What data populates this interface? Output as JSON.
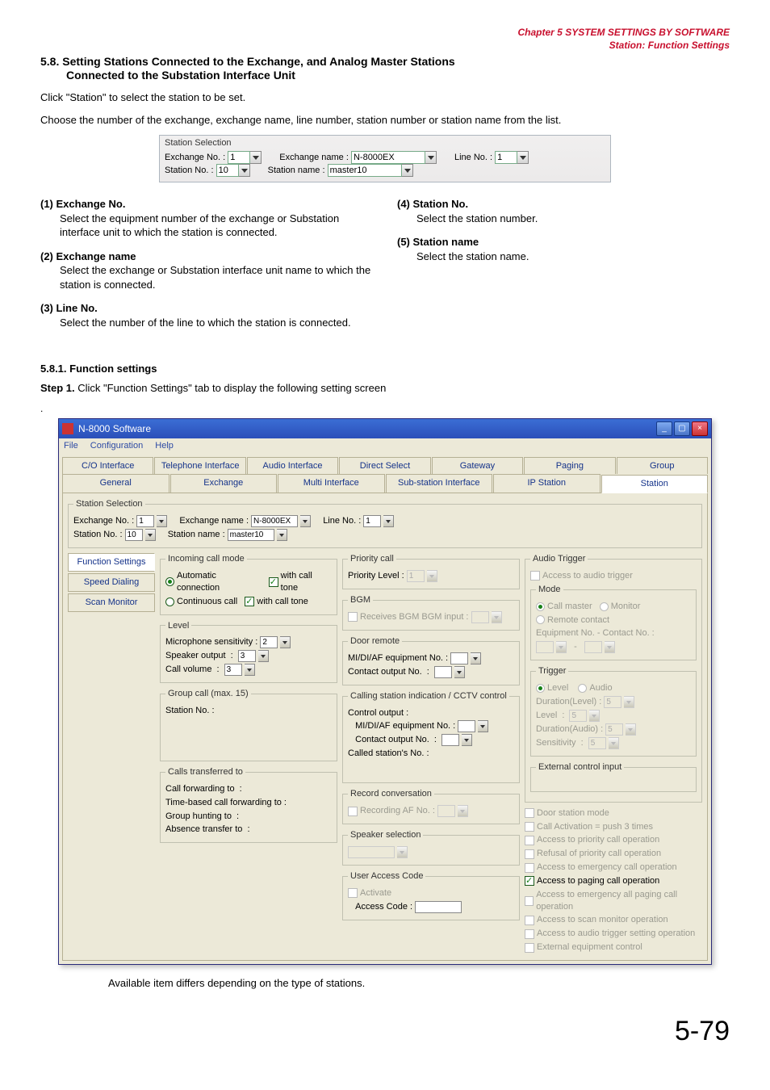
{
  "header": {
    "chapter_prefix": "Chapter 5",
    "chapter_rest": "   SYSTEM SETTINGS BY SOFTWARE",
    "subhead": "Station: Function Settings"
  },
  "section": {
    "title_line1": "5.8. Setting Stations Connected to the Exchange, and Analog Master Stations",
    "title_line2": "Connected to the Substation Interface Unit"
  },
  "intro1": "Click \"Station\" to select the station to be set.",
  "intro2": "Choose the number of the exchange, exchange name, line number, station number or station name from the list.",
  "selbox": {
    "legend": "Station Selection",
    "exch_no_label": "Exchange No. :",
    "exch_no_val": "1",
    "exch_name_label": "Exchange name :",
    "exch_name_val": "N-8000EX",
    "line_no_label": "Line No. :",
    "line_no_val": "1",
    "stn_no_label": "Station No.    :",
    "stn_no_val": "10",
    "stn_name_label": "Station name    :",
    "stn_name_val": "master10"
  },
  "items": {
    "n1": {
      "head": "(1)  Exchange No.",
      "body": "Select the equipment number of the exchange or Substation interface unit to which the station is connected."
    },
    "n2": {
      "head": "(2)  Exchange name",
      "body": "Select the exchange or Substation interface unit name to which the station is connected."
    },
    "n3": {
      "head": "(3)  Line No.",
      "body": "Select the number of the line to which the station is connected."
    },
    "n4": {
      "head": "(4)  Station No.",
      "body": "Select the station number."
    },
    "n5": {
      "head": "(5)  Station name",
      "body": "Select the station name."
    }
  },
  "substep": {
    "title": "5.8.1. Function settings",
    "step1_label": "Step 1.",
    "step1_text": " Click \"Function Settings\" tab to display the following setting screen"
  },
  "win": {
    "title": "N-8000 Software",
    "menus": [
      "File",
      "Configuration",
      "Help"
    ],
    "tabs_top": [
      "C/O Interface",
      "Telephone Interface",
      "Audio Interface",
      "Direct Select",
      "Gateway",
      "Paging",
      "Group"
    ],
    "tabs_bot": [
      "General",
      "Exchange",
      "Multi Interface",
      "Sub-station Interface",
      "IP Station",
      "Station"
    ],
    "vtabs": [
      "Function Settings",
      "Speed Dialing",
      "Scan Monitor"
    ],
    "selection": {
      "legend": "Station Selection",
      "exch_no_l": "Exchange No. :",
      "exch_no_v": "1",
      "exch_name_l": "Exchange name :",
      "exch_name_v": "N-8000EX",
      "line_no_l": "Line No. :",
      "line_no_v": "1",
      "stn_no_l": "Station No.    :",
      "stn_no_v": "10",
      "stn_name_l": "Station name    :",
      "stn_name_v": "master10"
    },
    "mid": {
      "incoming_legend": "Incoming call mode",
      "auto_conn": "Automatic connection",
      "with_tone1": "with call tone",
      "cont_call": "Continuous call",
      "with_tone2": "with call tone",
      "level_legend": "Level",
      "mic_sens": "Microphone sensitivity :",
      "mic_sens_v": "2",
      "spk_out": "Speaker output",
      "spk_out_v": "3",
      "call_vol": "Call volume",
      "call_vol_v": "3",
      "group_legend": "Group call (max. 15)",
      "stn_no_l": "Station No. :",
      "calls_transferred": "Calls transferred to",
      "call_forwarding": "Call forwarding to",
      "time_based": "Time-based call forwarding to :",
      "group_hunting": "Group hunting to",
      "absence": "Absence transfer to",
      "priority_legend": "Priority call",
      "priority_level_l": "Priority Level :",
      "priority_level_v": "1",
      "bgm_legend": "BGM",
      "receives_bgm": "Receives BGM   BGM input :",
      "door_legend": "Door remote",
      "midi_l": "MI/DI/AF equipment No. :",
      "contact_l": "Contact output No.",
      "cctv_legend": "Calling station indication / CCTV control",
      "control_output": "Control output :",
      "midi2_l": "MI/DI/AF equipment No. :",
      "contact2_l": "Contact output No.",
      "called_station": "Called station's No. :",
      "record_legend": "Record conversation",
      "recording": "Recording    AF No. :",
      "speaker_legend": "Speaker selection",
      "uac_legend": "User Access Code",
      "activate": "Activate",
      "access_code": "Access Code :"
    },
    "right": {
      "audio_legend": "Audio Trigger",
      "access_trigger": "Access to audio trigger",
      "mode_legend": "Mode",
      "call_master": "Call master",
      "monitor": "Monitor",
      "remote_contact": "Remote contact",
      "equip_no": "Equipment No. - Contact No. :",
      "dash": "-",
      "trigger_legend": "Trigger",
      "trig_level": "Level",
      "trig_audio": "Audio",
      "dur_level": "Duration(Level) :",
      "dur_level_v": "5",
      "level_l": "Level",
      "level_v": "5",
      "dur_audio": "Duration(Audio) :",
      "dur_audio_v": "5",
      "sens": "Sensitivity",
      "sens_v": "5",
      "ext_ctrl": "External control input",
      "door_station": "Door station mode",
      "call_activation": "Call Activation = push 3 times",
      "acc_priority": "Access to priority call operation",
      "ref_priority": "Refusal of priority call operation",
      "acc_emergency": "Access to emergency call operation",
      "acc_paging": "Access to paging call operation",
      "acc_emerg_paging": "Access to emergency all paging call operation",
      "acc_scan": "Access to scan monitor operation",
      "acc_audio_trig": "Access to audio trigger setting operation",
      "ext_equip": "External equipment control"
    }
  },
  "note_text": "Available item differs depending on the type of stations.",
  "pagenum": "5-79"
}
